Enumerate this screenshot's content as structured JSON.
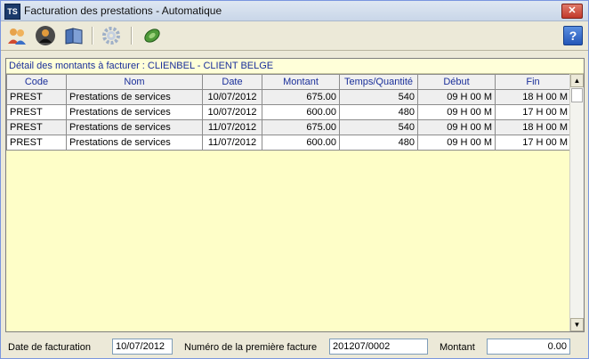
{
  "window": {
    "title": "Facturation des prestations - Automatique",
    "app_icon_text": "TS",
    "close_label": "✕",
    "help_label": "?"
  },
  "toolbar": {
    "buttons": [
      {
        "icon": "people-icon"
      },
      {
        "icon": "person-dark-icon"
      },
      {
        "icon": "book-icon"
      },
      {
        "icon": "gear-icon"
      },
      {
        "icon": "money-icon"
      }
    ]
  },
  "grid": {
    "title": "Détail des montants à facturer : CLIENBEL - CLIENT BELGE",
    "columns": [
      "Code",
      "Nom",
      "Date",
      "Montant",
      "Temps/Quantité",
      "Début",
      "Fin"
    ],
    "rows": [
      [
        "PREST",
        "Prestations de services",
        "10/07/2012",
        "675.00",
        "540",
        "09 H 00 M",
        "18 H 00 M"
      ],
      [
        "PREST",
        "Prestations de services",
        "10/07/2012",
        "600.00",
        "480",
        "09 H 00 M",
        "17 H 00 M"
      ],
      [
        "PREST",
        "Prestations de services",
        "11/07/2012",
        "675.00",
        "540",
        "09 H 00 M",
        "18 H 00 M"
      ],
      [
        "PREST",
        "Prestations de services",
        "11/07/2012",
        "600.00",
        "480",
        "09 H 00 M",
        "17 H 00 M"
      ]
    ]
  },
  "footer": {
    "date_label": "Date de facturation",
    "date_value": "10/07/2012",
    "invoice_label": "Numéro de la première facture",
    "invoice_value": "201207/0002",
    "amount_label": "Montant",
    "amount_value": "0.00"
  }
}
